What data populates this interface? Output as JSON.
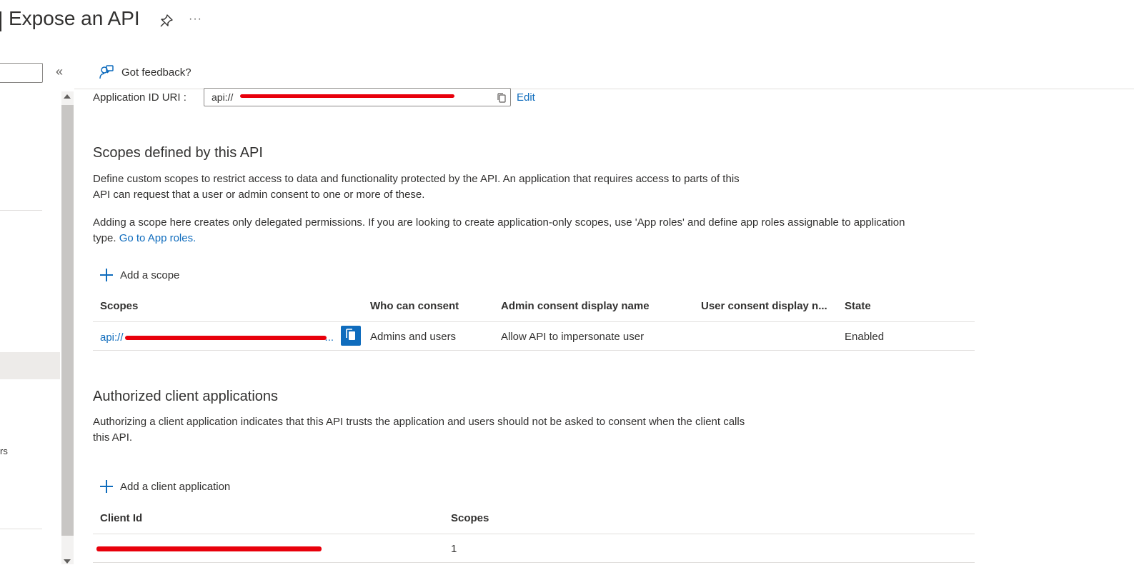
{
  "header": {
    "title": "Expose an API",
    "more_label": "···"
  },
  "sidebar": {
    "search_placeholder": "",
    "collapse_label": "«",
    "partial_item_label": "rs"
  },
  "toolbar": {
    "feedback_label": "Got feedback?"
  },
  "app_id_uri": {
    "label": "Application ID URI :",
    "value_prefix": "api://",
    "edit_label": "Edit"
  },
  "scopes_section": {
    "heading": "Scopes defined by this API",
    "description_1a": "Define custom scopes to restrict access to data and functionality protected by the API. An application that requires access to parts of this",
    "description_1b": "API can request that a user or admin consent to one or more of these.",
    "description_2a": "Adding a scope here creates only delegated permissions. If you are looking to create application-only scopes, use 'App roles' and define app roles assignable to application",
    "description_2b": "type.",
    "app_roles_link": "Go to App roles.",
    "add_label": "Add a scope",
    "columns": [
      "Scopes",
      "Who can consent",
      "Admin consent display name",
      "User consent display n...",
      "State"
    ],
    "rows": [
      {
        "scope_prefix": "api://",
        "scope_suffix": "...",
        "who_can_consent": "Admins and users",
        "admin_display_name": "Allow API to impersonate user",
        "user_display_name": "",
        "state": "Enabled"
      }
    ]
  },
  "clients_section": {
    "heading": "Authorized client applications",
    "description_a": "Authorizing a client application indicates that this API trusts the application and users should not be asked to consent when the client calls",
    "description_b": "this API.",
    "add_label": "Add a client application",
    "columns": [
      "Client Id",
      "Scopes"
    ],
    "rows": [
      {
        "client_id": "",
        "scopes": "1"
      }
    ]
  },
  "colors": {
    "accent": "#0f6cbd",
    "redaction": "#e8000b",
    "text": "#323130"
  }
}
